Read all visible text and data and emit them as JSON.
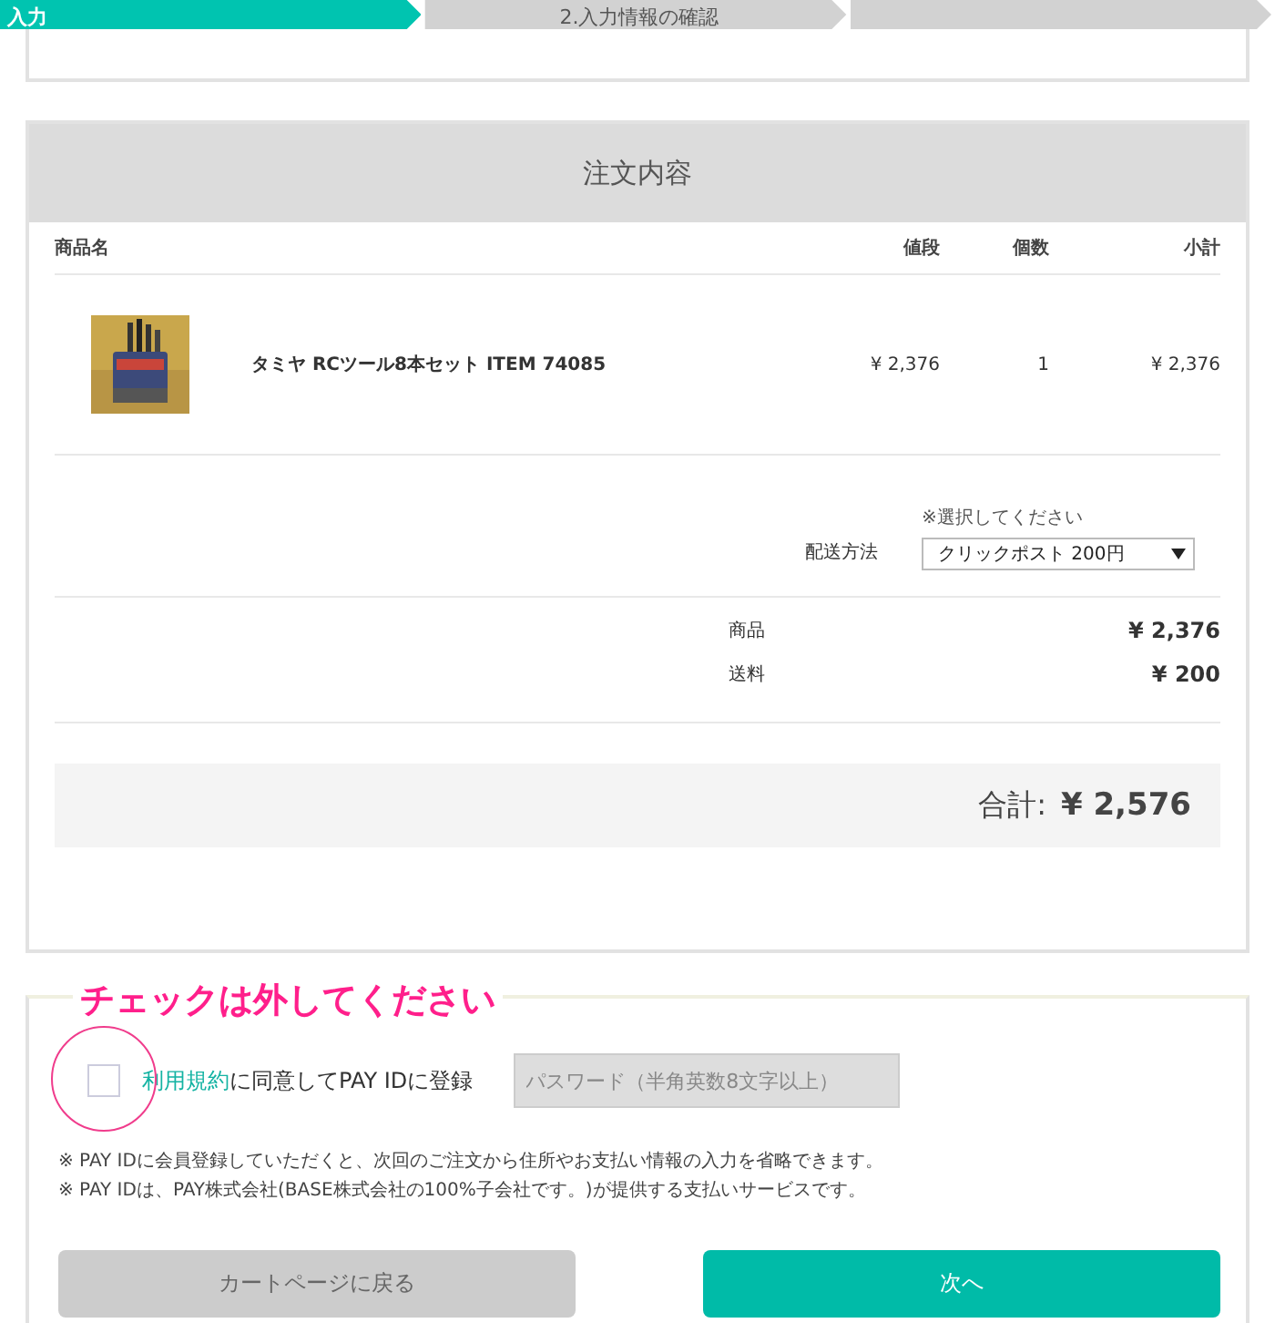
{
  "steps": [
    {
      "label": "入力",
      "selected": true
    },
    {
      "label": "2.入力情報の確認",
      "selected": false
    },
    {
      "selected": false
    }
  ],
  "order": {
    "title": "注文内容",
    "columns": [
      "商品名",
      "値段",
      "個数",
      "小計"
    ],
    "items": [
      {
        "name": "タミヤ RCツール8本セット ITEM 74085",
        "price": "¥ 2,376",
        "quantity": "1",
        "subtotal": "¥ 2,376"
      }
    ],
    "shipping": {
      "hint": "※選択してください",
      "label": "配送方法",
      "value": "クリックポスト 200円"
    },
    "summary": [
      {
        "label": "商品",
        "value": "¥ 2,376"
      },
      {
        "label": "送料",
        "value": "¥ 200"
      }
    ],
    "total": {
      "label": "合計:",
      "value": "¥ 2,576"
    }
  },
  "register": {
    "annotation": "チェックは外してください",
    "checked": false,
    "terms_link": "利用規約",
    "label": "に同意してPAY IDに登録",
    "password": {
      "placeholder": "パスワード（半角英数8文字以上）"
    },
    "notes": [
      "※ PAY IDに会員登録していただくと、次回のご注文から住所やお支払い情報の入力を省略できます。",
      "※ PAY IDは、PAY株式会社(BASE株式会社の100%子会社です。)が提供する支払いサービスです。"
    ]
  },
  "buttons": [
    {
      "kind": "secondary",
      "label": "カートページに戻る"
    },
    {
      "kind": "primary",
      "label": "次へ"
    }
  ]
}
